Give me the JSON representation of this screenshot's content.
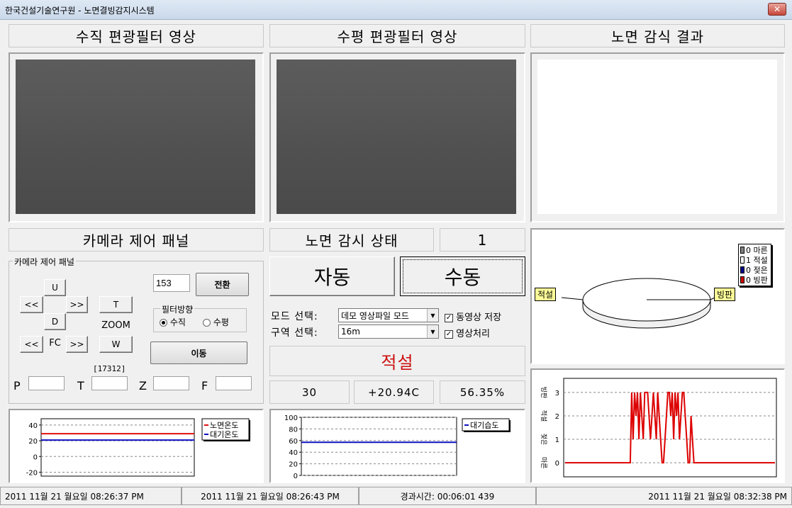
{
  "window": {
    "title": "한국건설기술연구원 - 노면결빙감지시스템",
    "close": "✕"
  },
  "headers": {
    "vertical": "수직 편광필터 영상",
    "horizontal": "수평 편광필터 영상",
    "result": "노면 감식 결과",
    "camera_panel": "카메라 제어 패널",
    "road_status": "노면 감시 상태",
    "road_status_value": "1"
  },
  "camera": {
    "group_label": "카메라 제어 패널",
    "up": "U",
    "down": "D",
    "left": "<<",
    "right": ">>",
    "t": "T",
    "w": "W",
    "zoom": "ZOOM",
    "fc_left": "<<",
    "fc": "FC",
    "fc_right": ">>",
    "preset_value": "153",
    "switch": "전환",
    "filter_group": "필터방향",
    "filter_vertical": "수직",
    "filter_horizontal": "수평",
    "move": "이동",
    "counter": "[17312]",
    "p_label": "P",
    "t_label": "T",
    "z_label": "Z",
    "f_label": "F",
    "p_value": "",
    "t_value": "",
    "z_value": "",
    "f_value": ""
  },
  "mode": {
    "auto": "자동",
    "manual": "수동",
    "mode_label": "모드 선택:",
    "mode_value": "데모 영상파일 모드",
    "zone_label": "구역 선택:",
    "zone_value": "16m",
    "save_video": "동영상 저장",
    "image_proc": "영상처리",
    "check_mark": "✓"
  },
  "result": {
    "state": "적설",
    "state_color": "#cc1111"
  },
  "readings": {
    "count": "30",
    "temp": "+20.94C",
    "humidity": "56.35%"
  },
  "pie": {
    "legend": [
      {
        "label": "0 마른",
        "color": "#808080"
      },
      {
        "label": "1 적설",
        "color": "#ffffff"
      },
      {
        "label": "0 젖은",
        "color": "#00008b"
      },
      {
        "label": "0 빙판",
        "color": "#cc0000"
      }
    ],
    "left_tag": "적설",
    "right_tag": "빙판"
  },
  "temp_chart": {
    "yticks": [
      "40",
      "20",
      "0",
      "-20"
    ],
    "ylim": [
      -25,
      48
    ],
    "series": [
      {
        "name": "노면온도",
        "color": "#e01010",
        "value": 29
      },
      {
        "name": "대기온도",
        "color": "#1010c0",
        "value": 20.9
      }
    ]
  },
  "humid_chart": {
    "yticks": [
      "100",
      "80",
      "60",
      "40",
      "20",
      "0"
    ],
    "ylim": [
      0,
      100
    ],
    "series": [
      {
        "name": "대기습도",
        "color": "#1010c0",
        "value": 57
      }
    ]
  },
  "state_chart": {
    "yticks": [
      "3",
      "2",
      "1",
      "0"
    ],
    "ylabels": [
      "빙판",
      "적설",
      "젖은",
      "마른"
    ],
    "ylim": [
      -0.6,
      3.6
    ],
    "series_color": "#dd0000",
    "values": [
      0,
      0,
      0,
      0,
      0,
      0,
      0,
      0,
      0,
      0,
      0,
      0,
      0,
      0,
      0,
      0,
      0,
      0,
      0,
      0,
      0,
      0,
      0,
      0,
      0,
      0,
      0,
      0,
      0,
      0,
      0,
      0,
      0,
      0,
      0,
      0,
      0,
      0,
      0,
      0,
      0,
      0,
      0,
      0,
      0,
      0,
      3,
      1,
      3,
      2,
      3,
      1,
      3,
      2,
      1,
      3,
      3,
      3,
      2,
      1,
      2,
      3,
      2,
      1,
      3,
      2,
      1,
      0,
      0,
      1,
      2,
      3,
      3,
      2,
      3,
      1,
      3,
      2,
      3,
      1,
      2,
      3,
      3,
      2,
      1,
      0,
      0,
      2,
      1,
      0,
      0,
      0,
      0,
      0,
      0,
      0,
      0,
      0,
      0,
      0,
      0,
      0,
      0,
      0,
      0,
      0,
      0,
      0,
      0,
      0,
      0,
      0,
      0,
      0,
      0,
      0,
      0,
      0,
      0,
      0,
      0,
      0,
      0,
      0,
      0,
      0,
      0,
      0,
      0,
      0,
      0,
      0,
      0,
      0,
      0,
      0,
      0,
      0,
      0,
      0,
      0,
      0,
      0,
      0,
      0,
      0
    ]
  },
  "statusbar": {
    "s1": "2011 11월 21 월요일 08:26:37 PM",
    "s2": "2011 11월 21 월요일 08:26:43 PM",
    "s3": "경과시간: 00:06:01 439",
    "s4": "2011 11월 21 월요일 08:32:38 PM"
  }
}
